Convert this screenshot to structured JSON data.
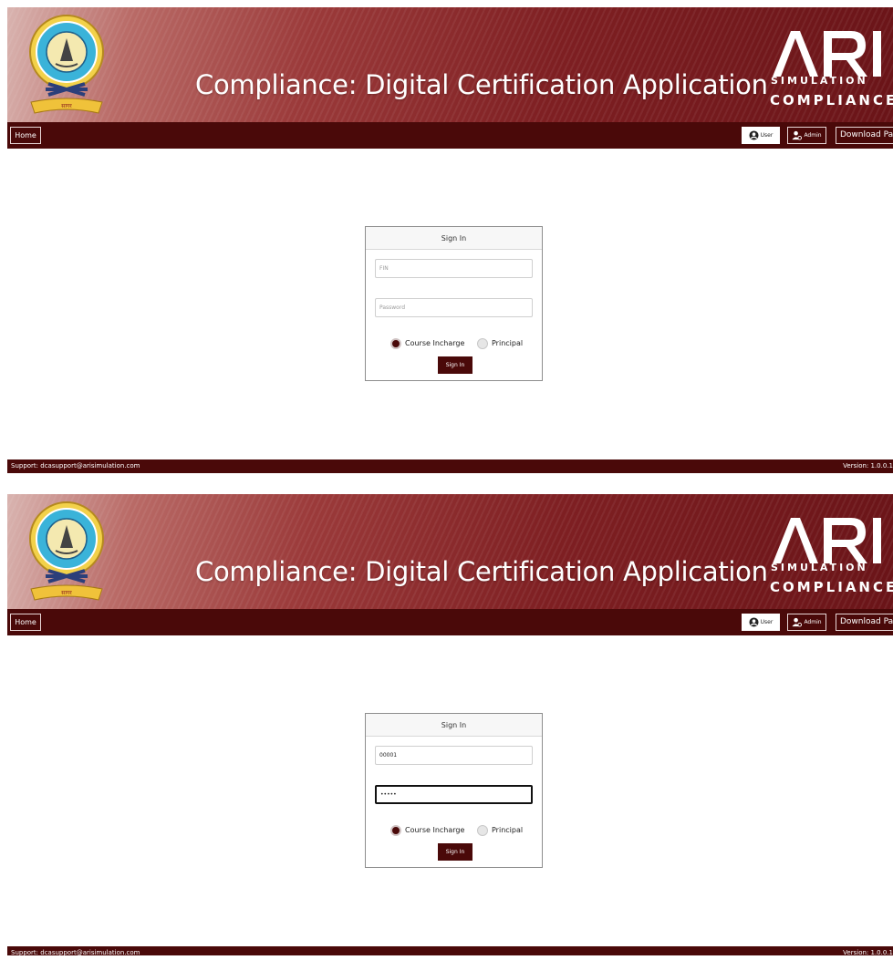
{
  "app": {
    "title": "Compliance: Digital Certification Application",
    "brand": "ARI",
    "brand_sub1": "SIMULATION",
    "brand_sub2": "COMPLIANCE",
    "emblem_text": "DIRECTORATE GENERAL OF SHIPPING · MUMBAI"
  },
  "nav": {
    "home": "Home",
    "user": "User",
    "admin": "Admin",
    "download": "Download Patch"
  },
  "screens": [
    {
      "signin_title": "Sign In",
      "fin_placeholder": "FIN",
      "fin_value": "",
      "password_placeholder": "Password",
      "password_value": "",
      "role_options": [
        "Course Incharge",
        "Principal"
      ],
      "selected_role": "Course Incharge",
      "submit": "Sign In"
    },
    {
      "signin_title": "Sign In",
      "fin_placeholder": "FIN",
      "fin_value": "00001",
      "password_placeholder": "Password",
      "password_value": "•••••",
      "role_options": [
        "Course Incharge",
        "Principal"
      ],
      "selected_role": "Course Incharge",
      "submit": "Sign In"
    }
  ],
  "footer": {
    "support": "Support: dcasupport@arisimulation.com",
    "version": "Version: 1.0.0.1"
  },
  "colors": {
    "maroon": "#4a0909",
    "header_light": "#d9b4b0",
    "header_dark": "#6a1418"
  }
}
